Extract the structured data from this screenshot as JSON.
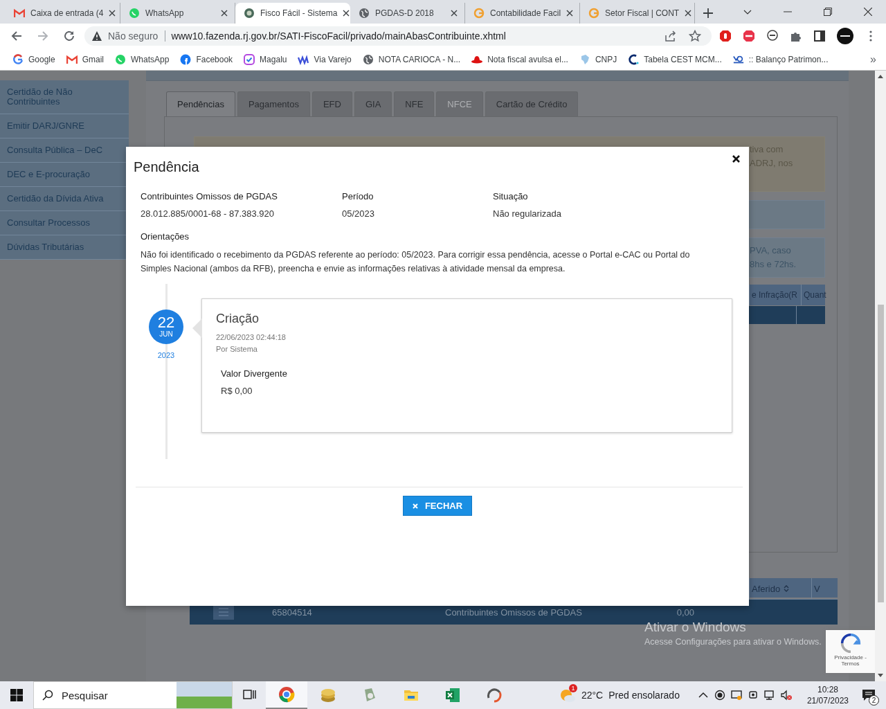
{
  "browser": {
    "tabs": [
      {
        "title": "Caixa de entrada (4",
        "kind": "mail",
        "selected": false
      },
      {
        "title": "WhatsApp",
        "kind": "chat",
        "selected": false
      },
      {
        "title": "Fisco Fácil - Sistema",
        "kind": "crest",
        "selected": true
      },
      {
        "title": "PGDAS-D 2018",
        "kind": "globe",
        "selected": false
      },
      {
        "title": "Contabilidade Facil",
        "kind": "swirl",
        "selected": false
      },
      {
        "title": "Setor Fiscal | CONT",
        "kind": "swirl",
        "selected": false
      }
    ],
    "address": {
      "security": "Não seguro",
      "url": "www10.fazenda.rj.gov.br/SATI-FiscoFacil/privado/mainAbasContribuinte.xhtml"
    },
    "bookmarks": [
      {
        "label": "Google",
        "kind": "google"
      },
      {
        "label": "Gmail",
        "kind": "mail"
      },
      {
        "label": "WhatsApp",
        "kind": "chat"
      },
      {
        "label": "Facebook",
        "kind": "facebook"
      },
      {
        "label": "Magalu",
        "kind": "check"
      },
      {
        "label": "Via Varejo",
        "kind": "vv"
      },
      {
        "label": "NOTA CARIOCA - N...",
        "kind": "globe"
      },
      {
        "label": "Nota fiscal avulsa el...",
        "kind": "hat"
      },
      {
        "label": "CNPJ",
        "kind": "map"
      },
      {
        "label": "Tabela CEST MCM...",
        "kind": "letter"
      },
      {
        "label": ":: Balanço Patrimon...",
        "kind": "logo"
      }
    ],
    "bookmarks_more": "»"
  },
  "page": {
    "sidebar": {
      "items": [
        "Certidão de Não Contribuintes",
        "Emitir DARJ/GNRE",
        "Consulta Pública – DeC",
        "DEC e E-procuração",
        "Certidão da Dívida Ativa",
        "Consultar Processos",
        "Dúvidas Tributárias"
      ]
    },
    "tabs": [
      {
        "label": "Pendências",
        "selected": true,
        "disabled": false
      },
      {
        "label": "Pagamentos",
        "selected": false,
        "disabled": false
      },
      {
        "label": "EFD",
        "selected": false,
        "disabled": false
      },
      {
        "label": "GIA",
        "selected": false,
        "disabled": false
      },
      {
        "label": "NFE",
        "selected": false,
        "disabled": false
      },
      {
        "label": "NFCE",
        "selected": false,
        "disabled": true
      },
      {
        "label": "Cartão de Crédito",
        "selected": false,
        "disabled": false
      }
    ],
    "notices": [
      {
        "kind": "warning",
        "lines": [
          "tiva com",
          "ADRJ, nos"
        ]
      },
      {
        "kind": "info"
      },
      {
        "kind": "info",
        "lines": [
          "PVA, caso",
          "8hs e 72hs."
        ]
      }
    ],
    "top_table": {
      "columns": [
        "e Infração(R",
        "Quant"
      ]
    },
    "bottom_table": {
      "columns": [
        "Aferido",
        "V"
      ],
      "rows": [
        {
          "cells": [
            "65804514",
            "Contribuintes Omissos de PGDAS",
            "0,00"
          ]
        }
      ]
    }
  },
  "modal": {
    "title": "Pendência",
    "fields": [
      {
        "label": "Contribuintes Omissos de PGDAS",
        "value": "28.012.885/0001-68 - 87.383.920"
      },
      {
        "label": "Período",
        "value": "05/2023"
      },
      {
        "label": "Situação",
        "value": "Não regularizada"
      }
    ],
    "guidance_label": "Orientações",
    "guidance": "Não foi identificado o recebimento da PGDAS referente ao período: 05/2023. Para corrigir essa pendência, acesse o Portal e-CAC ou Portal do Simples Nacional (ambos da RFB), preencha e envie as informações relativas à atividade mensal da empresa.",
    "timeline": [
      {
        "day": "22",
        "month": "JUN",
        "year": "2023",
        "title": "Criação",
        "timestamp": "22/06/2023 02:44:18",
        "author": "Por Sistema",
        "detail_label": "Valor Divergente",
        "detail_value": "R$ 0,00"
      }
    ],
    "button": "FECHAR"
  },
  "windows_notice": {
    "title": "Ativar o Windows",
    "text": "Acesse Configurações para ativar o Windows."
  },
  "recaptcha": {
    "text": "Privacidade - Termos"
  },
  "taskbar": {
    "search_placeholder": "Pesquisar",
    "weather": {
      "badge": "1",
      "temperature": "22°C",
      "text": "Pred ensolarado"
    },
    "time": "10:28",
    "date": "21/07/2023",
    "notifications": "2"
  }
}
